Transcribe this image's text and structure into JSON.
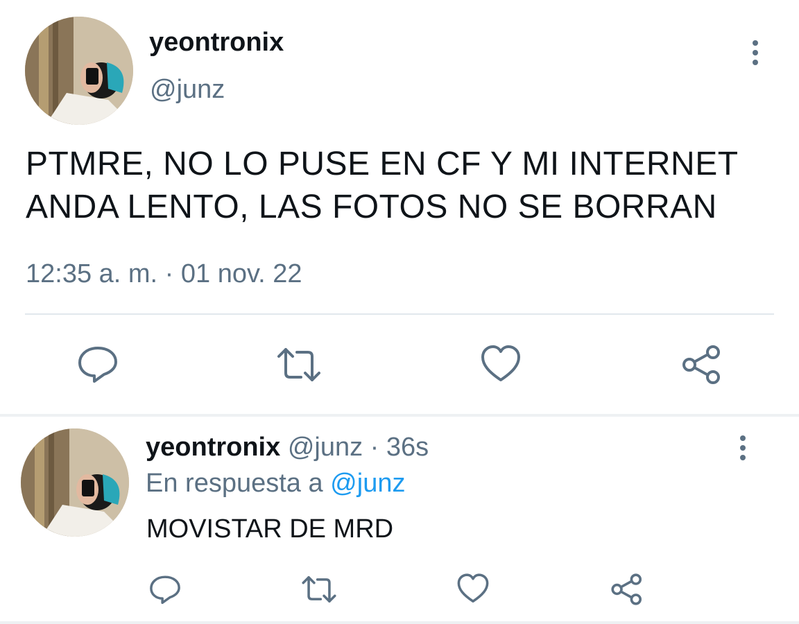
{
  "main_tweet": {
    "display_name": "yeontronix",
    "handle": "@junz",
    "text_line1": "PTMRE, NO LO PUSE EN CF Y MI INTERNET",
    "text_line2": "ANDA LENTO, LAS FOTOS NO SE BORRAN",
    "timestamp": "12:35 a. m. · 01 nov. 22"
  },
  "reply_tweet": {
    "display_name": "yeontronix",
    "handle": "@junz",
    "time": "· 36s",
    "reply_prefix": "En respuesta a",
    "reply_to": "@junz",
    "text": "MOVISTAR DE MRD"
  },
  "icons": {
    "reply": "reply-icon",
    "retweet": "retweet-icon",
    "like": "heart-icon",
    "share": "share-icon",
    "more": "more-options-icon"
  },
  "colors": {
    "text": "#0f1419",
    "muted": "#5b7083",
    "link": "#1d9bf0",
    "divider": "#e1e8ed"
  }
}
